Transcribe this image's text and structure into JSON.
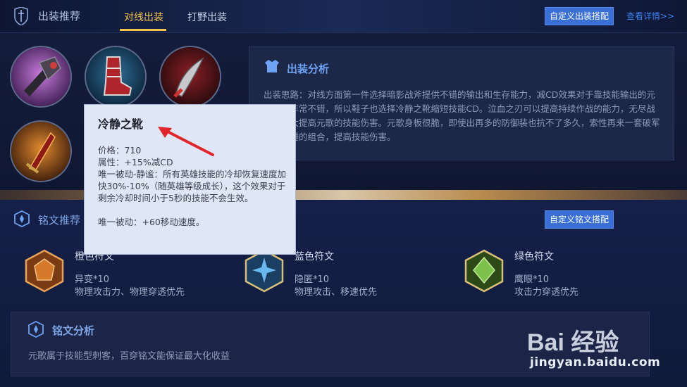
{
  "header": {
    "title": "出装推荐",
    "tabs": [
      {
        "label": "对线出装",
        "active": true
      },
      {
        "label": "打野出装",
        "active": false
      }
    ],
    "custom_build_button": "自定义出装搭配",
    "more_link": "查看详情>>"
  },
  "items": [
    {
      "name": "暗影战斧",
      "icon": "dark-axe-icon"
    },
    {
      "name": "冷静之靴",
      "icon": "calm-boots-icon"
    },
    {
      "name": "泣血之刃",
      "icon": "bloodthirsty-blade-icon"
    },
    {
      "name": "破军",
      "icon": "doom-blade-icon"
    }
  ],
  "build_analysis": {
    "title": "出装分析",
    "text": "出装思路：对线方面第一件选择暗影战斧提供不错的输出和生存能力，减CD效果对于靠技能输出的元歌来说非常不错，所以鞋子也选择冷静之靴缩短技能CD。泣血之刃可以提高持续作战的能力，无尽战刃则大大提高元歌的技能伤害。元歌身板很脆，即使出再多的防御装也抗不了多久，索性再来一套破军加碎星锤的组合，提高技能伤害。"
  },
  "tooltip": {
    "name": "冷静之靴",
    "price": "价格：710",
    "attribute": "属性：+15%减CD",
    "passive1": "唯一被动-静谧：所有英雄技能的冷却恢复速度加快30%-10%（随英雄等级成长），这个效果对于剩余冷却时间小于5秒的技能不会生效。",
    "passive2": "唯一被动：+60移动速度。"
  },
  "runes": {
    "title": "铭文推荐",
    "custom_button": "自定义铭文搭配",
    "list": [
      {
        "name": "橙色符文",
        "count": "异变*10",
        "desc": "物理攻击力、物理穿透优先",
        "color": "#c9692a"
      },
      {
        "name": "蓝色符文",
        "count": "隐匿*10",
        "desc": "物理攻击、移速优先",
        "color": "#3b8ed6"
      },
      {
        "name": "绿色符文",
        "count": "鹰眼*10",
        "desc": "攻击力穿透优先",
        "color": "#4fa23a"
      }
    ]
  },
  "rune_analysis": {
    "title": "铭文分析",
    "text": "元歌属于技能型刺客，百穿铭文能保证最大化收益"
  },
  "watermark": {
    "text": "jingyan.baidu.com",
    "logo_text": "Bai 经验"
  },
  "colors": {
    "accent": "#f2c44b",
    "button": "#3a6fd8",
    "panel": "#1d2748"
  }
}
